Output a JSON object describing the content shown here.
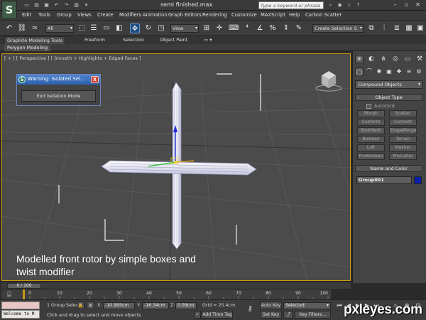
{
  "window": {
    "title": "semi finished.max",
    "app_logo": "S",
    "search_placeholder": "Type a keyword or phrase"
  },
  "menus": [
    "Edit",
    "Tools",
    "Group",
    "Views",
    "Create",
    "Modifiers",
    "Animation",
    "Graph Editors",
    "Rendering",
    "Customize",
    "MAXScript",
    "Help",
    "Carbon Scatter"
  ],
  "toolbar": {
    "selection_filter": "All",
    "reference_coord": "View",
    "named_selection": "Create Selection S"
  },
  "ribbon": {
    "tabs": [
      "Graphite Modeling Tools",
      "Freeform",
      "Selection",
      "Object Paint"
    ],
    "active_tab": "Graphite Modeling Tools",
    "sub_label": "Polygon Modeling"
  },
  "viewport": {
    "label": "[ + ] [ Perspective ] [ Smooth + Highlights + Edged Faces ]",
    "caption_line1": "Modelled front  rotor by simple boxes and",
    "caption_line2": "twist modifier"
  },
  "iso_dialog": {
    "title": "Warning: Isolated Sel...",
    "icon": "S",
    "close": "X",
    "exit_button": "Exit Isolation Mode"
  },
  "command_panel": {
    "category": "Compound Objects",
    "object_type_header": "Object Type",
    "autogrid_label": "AutoGrid",
    "object_buttons": [
      "Morph",
      "Scatter",
      "Conform",
      "Connect",
      "BlobMesh",
      "ShapeMerge",
      "Boolean",
      "Terrain",
      "Loft",
      "Mesher",
      "ProBoolean",
      "ProCutter"
    ],
    "name_color_header": "Name and Color",
    "object_name": "Group001",
    "object_color": "#0b1ea8"
  },
  "timeline": {
    "slider_label": "0 / 100",
    "ticks": [
      "0",
      "10",
      "20",
      "30",
      "40",
      "50",
      "60",
      "70",
      "80",
      "90",
      "100"
    ]
  },
  "status": {
    "maxscript_text": "Welcome to M",
    "selection_info": "1 Group Selec",
    "prompt": "Click and drag to select and move objects",
    "x_label": "X:",
    "x_value": "-10.995cm",
    "y_label": "Y:",
    "y_value": "-16.34cm",
    "z_label": "Z:",
    "z_value": "0.09cm",
    "grid": "Grid = 25.4cm",
    "add_time_tag": "Add Time Tag",
    "auto_key": "Auto Key",
    "set_key": "Set Key",
    "key_mode": "Selected",
    "key_filters": "Key Filters..."
  },
  "watermark": "pxleyes.com"
}
